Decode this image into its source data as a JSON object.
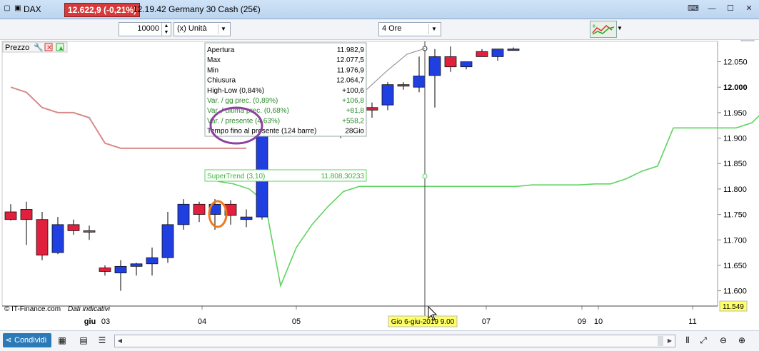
{
  "titlebar": {
    "ticker": "DAX",
    "price_badge": "12.622,9 (-0,21%)",
    "title": "12.19.42 Germany 30 Cash (25€)",
    "icons": [
      "page-icon",
      "window-icon"
    ],
    "window_buttons": [
      "keyboard-icon",
      "minimize-icon",
      "maximize-icon",
      "close-icon"
    ]
  },
  "toolbar": {
    "quantity": "10000",
    "unit": "(x) Unità",
    "timeframe": "4 Ore"
  },
  "chart": {
    "label": "Prezzo",
    "copyright": "© IT-Finance.com",
    "note": "Dati indicativi",
    "last_price_badge": "11.549",
    "crosshair_date": "Gio 6-giu-2019 9.00",
    "price_ticks": [
      "12.050",
      "12.000",
      "11.950",
      "11.900",
      "11.850",
      "11.800",
      "11.750",
      "11.700",
      "11.650",
      "11.600"
    ],
    "date_ticks": [
      "giu",
      "03",
      "04",
      "05",
      "07",
      "09",
      "10",
      "11"
    ]
  },
  "tooltip": {
    "rows": [
      {
        "label": "Apertura",
        "value": "11.982,9",
        "color": "#000000"
      },
      {
        "label": "Max",
        "value": "12.077,5",
        "color": "#000000"
      },
      {
        "label": "Min",
        "value": "11.976,9",
        "color": "#000000"
      },
      {
        "label": "Chiusura",
        "value": "12.064,7",
        "color": "#000000"
      },
      {
        "label": "High-Low (0,84%)",
        "value": "+100,6",
        "color": "#000000"
      },
      {
        "label": "Var. / gg prec. (0,89%)",
        "value": "+106,8",
        "color": "#2a8a2a"
      },
      {
        "label": "Var. / ultima prec. (0,68%)",
        "value": "+81,8",
        "color": "#2a8a2a"
      },
      {
        "label": "Var. / presente (4,63%)",
        "value": "+558,2",
        "color": "#2a8a2a"
      },
      {
        "label": "Tempo fino al presente (124 barre)",
        "value": "28Gio",
        "color": "#000000"
      }
    ],
    "supertrend_label": "SuperTrend (3,10)",
    "supertrend_value": "11.808,30233"
  },
  "bottombar": {
    "share_label": "Condividi",
    "icons": [
      "share-icon",
      "grid-icon",
      "document-icon",
      "bars-icon",
      "zoom-fit-icon",
      "zoom-out-icon",
      "zoom-in-icon"
    ]
  },
  "colors": {
    "bull": "#1f3fe0",
    "bear": "#e0203c",
    "supertrend_up": "#5fd35f",
    "supertrend_down": "#d98a8a",
    "highlight_circle": "#8e3fa0",
    "highlight_small": "#f07a1a",
    "badge": "#ffff66"
  },
  "chart_data": {
    "type": "candlestick",
    "candles": [
      {
        "o": 11755,
        "h": 11770,
        "l": 11738,
        "c": 11740
      },
      {
        "o": 11760,
        "h": 11775,
        "l": 11690,
        "c": 11740
      },
      {
        "o": 11740,
        "h": 11755,
        "l": 11660,
        "c": 11670
      },
      {
        "o": 11675,
        "h": 11745,
        "l": 11672,
        "c": 11730
      },
      {
        "o": 11730,
        "h": 11740,
        "l": 11710,
        "c": 11718
      },
      {
        "o": 11718,
        "h": 11728,
        "l": 11700,
        "c": 11716
      },
      {
        "o": 11645,
        "h": 11650,
        "l": 11630,
        "c": 11638
      },
      {
        "o": 11635,
        "h": 11660,
        "l": 11600,
        "c": 11648
      },
      {
        "o": 11648,
        "h": 11655,
        "l": 11630,
        "c": 11653
      },
      {
        "o": 11653,
        "h": 11685,
        "l": 11630,
        "c": 11665
      },
      {
        "o": 11665,
        "h": 11755,
        "l": 11655,
        "c": 11730
      },
      {
        "o": 11730,
        "h": 11780,
        "l": 11720,
        "c": 11770
      },
      {
        "o": 11770,
        "h": 11775,
        "l": 11735,
        "c": 11750
      },
      {
        "o": 11750,
        "h": 11780,
        "l": 11720,
        "c": 11770
      },
      {
        "o": 11770,
        "h": 11778,
        "l": 11730,
        "c": 11748
      },
      {
        "o": 11740,
        "h": 11760,
        "l": 11725,
        "c": 11745
      },
      {
        "o": 11745,
        "h": 11960,
        "l": 11740,
        "c": 11920
      },
      {
        "o": 11945,
        "h": 11970,
        "l": 11930,
        "c": 11960
      },
      {
        "o": 11960,
        "h": 11980,
        "l": 11945,
        "c": 11975
      },
      {
        "o": 11975,
        "h": 11985,
        "l": 11955,
        "c": 11980
      },
      {
        "o": 11983,
        "h": 12077,
        "l": 11977,
        "c": 12065
      },
      {
        "o": 12065,
        "h": 12075,
        "l": 11900,
        "c": 11940
      },
      {
        "o": 11940,
        "h": 11965,
        "l": 11935,
        "c": 11955
      },
      {
        "o": 11960,
        "h": 11970,
        "l": 11940,
        "c": 11955
      },
      {
        "o": 11965,
        "h": 12010,
        "l": 11955,
        "c": 12005
      },
      {
        "o": 12005,
        "h": 12010,
        "l": 11995,
        "c": 12002
      },
      {
        "o": 12000,
        "h": 12060,
        "l": 11990,
        "c": 12022
      },
      {
        "o": 12023,
        "h": 12075,
        "l": 11960,
        "c": 12060
      },
      {
        "o": 12060,
        "h": 12080,
        "l": 12030,
        "c": 12040
      },
      {
        "o": 12040,
        "h": 12050,
        "l": 12035,
        "c": 12050
      },
      {
        "o": 12070,
        "h": 12075,
        "l": 12060,
        "c": 12060
      },
      {
        "o": 12060,
        "h": 12075,
        "l": 12052,
        "c": 12075
      },
      {
        "o": 12075,
        "h": 12078,
        "l": 12072,
        "c": 12075
      }
    ],
    "supertrend_upper": [
      12000,
      11990,
      11960,
      11950,
      11950,
      11940,
      11890,
      11880,
      11880,
      11880,
      11880,
      11880,
      11880,
      11880,
      11880,
      11880
    ],
    "supertrend_lower": [
      11815,
      11810,
      11800,
      11775,
      11610,
      11685,
      11730,
      11765,
      11795,
      11805,
      11805,
      11805,
      11805,
      11805,
      11805,
      11805,
      11805,
      11805,
      11805,
      11805,
      11808,
      11808,
      11808,
      11808,
      11810,
      11810,
      11820,
      11835,
      11845,
      11920,
      11920,
      11920,
      11920,
      11920,
      11930,
      11960
    ],
    "ylim": [
      11570,
      12090
    ],
    "grid": false
  }
}
